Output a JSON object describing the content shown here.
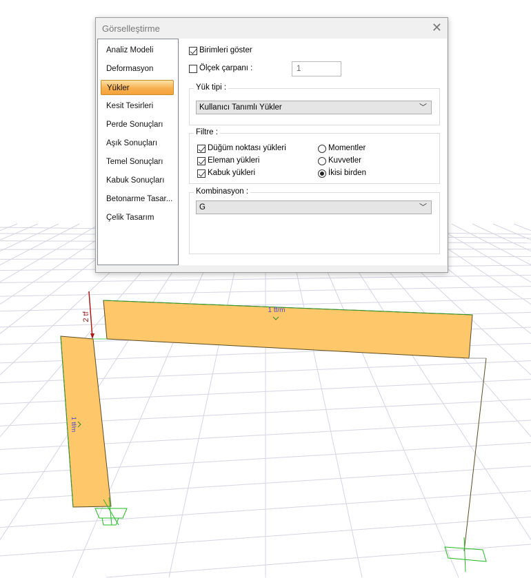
{
  "dialog": {
    "title": "Görselleştirme",
    "close_icon": "close-icon",
    "nav": [
      "Analiz Modeli",
      "Deformasyon",
      "Yükler",
      "Kesit Tesirleri",
      "Perde Sonuçları",
      "Aşık Sonuçları",
      "Temel Sonuçları",
      "Kabuk Sonuçları",
      "Betonarme Tasar...",
      "Çelik Tasarım"
    ],
    "selected_nav": "Yükler",
    "show_units": {
      "label": "Birimleri göster",
      "checked": true
    },
    "scale": {
      "label": "Ölçek çarpanı :",
      "checked": false,
      "value": "1"
    },
    "load_type": {
      "label": "Yük tipi :",
      "value": "Kullanıcı Tanımlı Yükler"
    },
    "filter": {
      "label": "Filtre :",
      "checks": [
        {
          "label": "Düğüm noktası yükleri",
          "checked": true
        },
        {
          "label": "Eleman yükleri",
          "checked": true
        },
        {
          "label": "Kabuk yükleri",
          "checked": true
        }
      ],
      "radios": [
        {
          "label": "Momentler",
          "checked": false
        },
        {
          "label": "Kuvvetler",
          "checked": false
        },
        {
          "label": "İkisi birden",
          "checked": true
        }
      ]
    },
    "combination": {
      "label": "Kombinasyon :",
      "value": "G"
    }
  },
  "scene": {
    "beam_load": "1 tf/m",
    "column_load": "1 tf/m",
    "point_load": "2 tf",
    "load_fill": "#fdc76a"
  }
}
